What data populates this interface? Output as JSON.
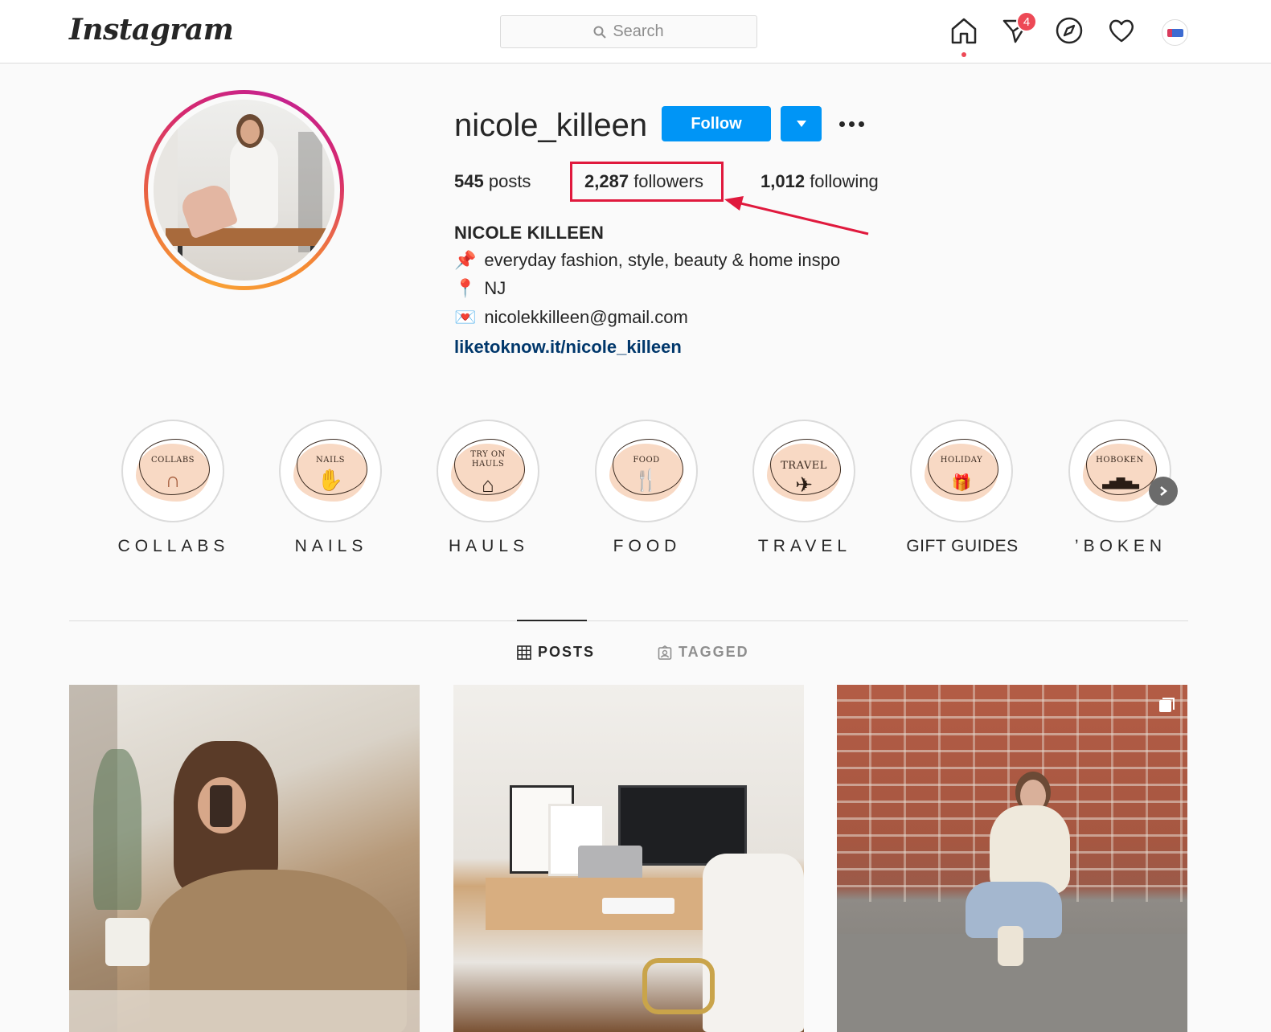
{
  "header": {
    "logo": "Instagram",
    "search_placeholder": "Search",
    "nav": {
      "home_icon": "home-icon",
      "direct_icon": "direct-message-icon",
      "direct_badge": "4",
      "explore_icon": "compass-icon",
      "activity_icon": "heart-icon"
    }
  },
  "profile": {
    "username": "nicole_killeen",
    "follow_label": "Follow",
    "stats": {
      "posts_count": "545",
      "posts_label": "posts",
      "followers_count": "2,287",
      "followers_label": "followers",
      "following_count": "1,012",
      "following_label": "following"
    },
    "full_name": "NICOLE KILLEEN",
    "bio": [
      {
        "icon": "pushpin-emoji",
        "emoji": "📌",
        "text": "everyday fashion, style, beauty & home inspo"
      },
      {
        "icon": "round-pushpin-emoji",
        "emoji": "📍",
        "text": "NJ"
      },
      {
        "icon": "love-letter-emoji",
        "emoji": "💌",
        "text": "nicolekkilleen@gmail.com"
      }
    ],
    "link": "liketoknow.it/nicole_killeen"
  },
  "highlights": [
    {
      "cover_text": "COLLABS",
      "glyph": "∩",
      "label": "COLLABS"
    },
    {
      "cover_text": "NAILS",
      "glyph": "✋",
      "label": "NAILS"
    },
    {
      "cover_text": "TRY ON HAULS",
      "glyph": "⌂",
      "label": "HAULS"
    },
    {
      "cover_text": "FOOD",
      "glyph": "🍴",
      "label": "FOOD"
    },
    {
      "cover_text": "TRAVEL",
      "glyph": "✈",
      "label": "TRAVEL"
    },
    {
      "cover_text": "HOLIDAY",
      "glyph": "🎁",
      "label": "GIFT GUIDES"
    },
    {
      "cover_text": "HOBOKEN",
      "glyph": "▃▅▇▅▃",
      "label": "’BOKEN"
    }
  ],
  "tabs": {
    "posts": "POSTS",
    "tagged": "TAGGED"
  },
  "colors": {
    "accent": "#0095f6",
    "highlight_box": "#e0193d",
    "link": "#00376b",
    "badge": "#ed4956"
  }
}
